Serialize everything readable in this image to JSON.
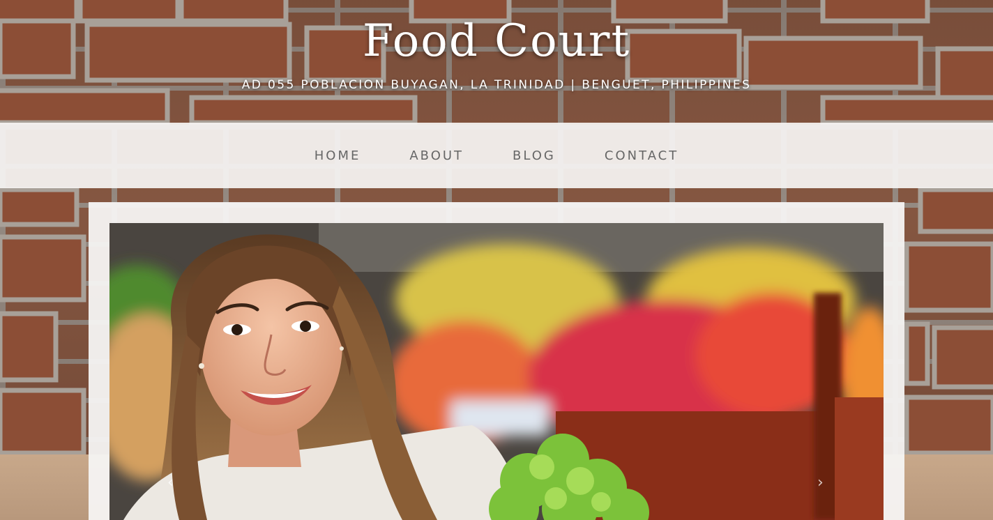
{
  "header": {
    "site_title": "Food Court",
    "address": "AD 055 POBLACION BUYAGAN, LA TRINIDAD | BENGUET, PHILIPPINES"
  },
  "nav": {
    "items": [
      {
        "label": "HOME"
      },
      {
        "label": "ABOUT"
      },
      {
        "label": "BLOG"
      },
      {
        "label": "CONTACT"
      }
    ]
  },
  "slider": {
    "prev_icon": "‹",
    "next_icon": "›"
  },
  "colors": {
    "nav_text": "#666666",
    "header_text": "#ffffff",
    "nav_background": "#f6f4f3"
  }
}
